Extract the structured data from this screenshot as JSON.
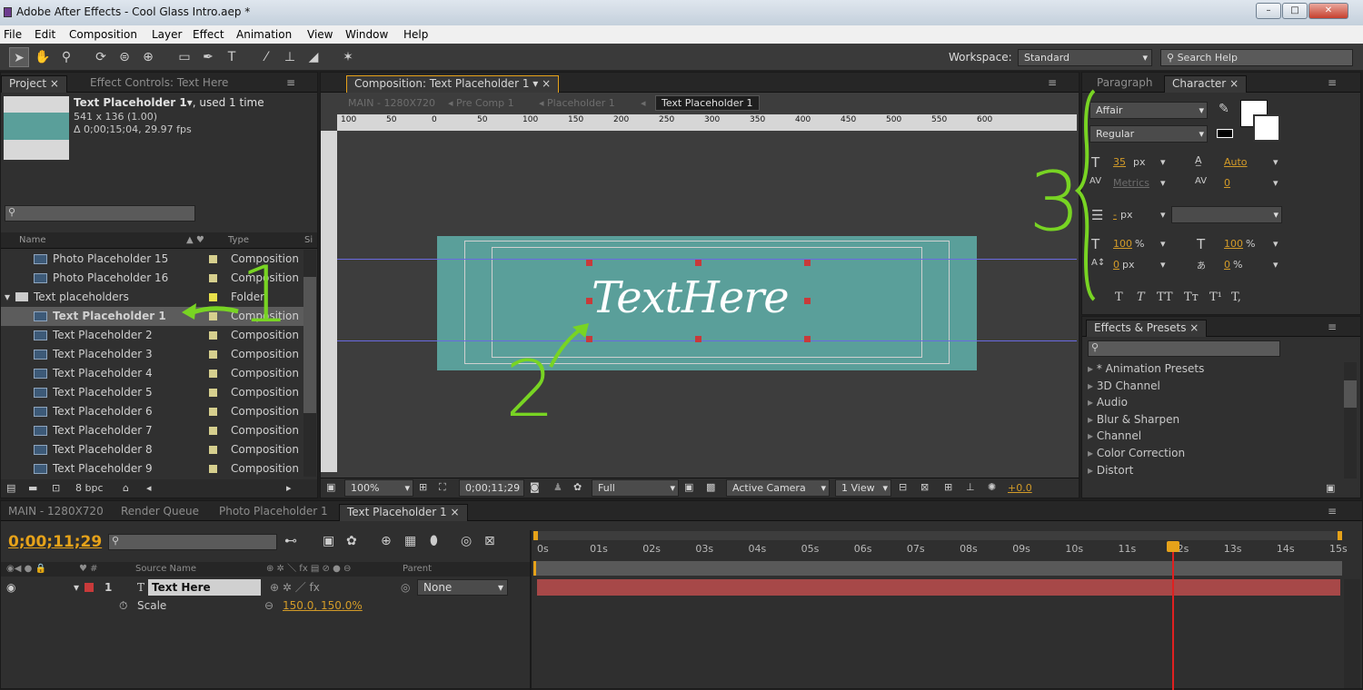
{
  "window": {
    "title": "Adobe After Effects - Cool Glass Intro.aep *",
    "min": "–",
    "max": "□",
    "close": "✕"
  },
  "menu": [
    "File",
    "Edit",
    "Composition",
    "Layer",
    "Effect",
    "Animation",
    "View",
    "Window",
    "Help"
  ],
  "workspace": {
    "label": "Workspace:",
    "value": "Standard",
    "search_placeholder": "Search Help"
  },
  "project": {
    "tab": "Project",
    "effect_tab": "Effect Controls: Text Here",
    "comp_name": "Text Placeholder 1▾",
    "used": ", used 1 time",
    "dims": "541 x 136 (1.00)",
    "duration": "Δ 0;00;15;04, 29.97 fps",
    "col_name": "Name",
    "col_type": "Type",
    "col_size": "Si",
    "items": [
      {
        "name": "Photo Placeholder 15",
        "type": "Composition"
      },
      {
        "name": "Photo Placeholder 16",
        "type": "Composition"
      },
      {
        "name": "Text placeholders",
        "type": "Folder"
      },
      {
        "name": "Text Placeholder 1",
        "type": "Composition"
      },
      {
        "name": "Text Placeholder 2",
        "type": "Composition"
      },
      {
        "name": "Text Placeholder 3",
        "type": "Composition"
      },
      {
        "name": "Text Placeholder 4",
        "type": "Composition"
      },
      {
        "name": "Text Placeholder 5",
        "type": "Composition"
      },
      {
        "name": "Text Placeholder 6",
        "type": "Composition"
      },
      {
        "name": "Text Placeholder 7",
        "type": "Composition"
      },
      {
        "name": "Text Placeholder 8",
        "type": "Composition"
      },
      {
        "name": "Text Placeholder 9",
        "type": "Composition"
      }
    ],
    "bpc": "8 bpc"
  },
  "composition": {
    "tab": "Composition: Text Placeholder 1",
    "crumbs": [
      "MAIN - 1280X720",
      "Pre Comp 1",
      "Placeholder 1",
      "Text Placeholder 1"
    ],
    "ruler": [
      "100",
      "50",
      "0",
      "50",
      "100",
      "150",
      "200",
      "250",
      "300",
      "350",
      "400",
      "450",
      "500",
      "550",
      "600"
    ],
    "canvas_text": "TextHere",
    "zoom": "100%",
    "time": "0;00;11;29",
    "res": "Full",
    "camera": "Active Camera",
    "view": "1 View",
    "exposure": "+0.0"
  },
  "character": {
    "tab_para": "Paragraph",
    "tab_char": "Character",
    "font": "Affair",
    "style": "Regular",
    "size": "35",
    "size_unit": "px",
    "leading": "Auto",
    "kern": "Metrics",
    "track": "0",
    "stroke": "-",
    "stroke_unit": "px",
    "vscale": "100",
    "hscale": "100",
    "pct": "%",
    "baseline": "0",
    "base_unit": "px",
    "tsume": "0",
    "tsume_unit": "%",
    "styles": [
      "T",
      "T",
      "TT",
      "Tт",
      "T¹",
      "T,"
    ]
  },
  "effects": {
    "tab": "Effects & Presets",
    "items": [
      "* Animation Presets",
      "3D Channel",
      "Audio",
      "Blur & Sharpen",
      "Channel",
      "Color Correction",
      "Distort"
    ]
  },
  "timeline": {
    "tabs": [
      "MAIN - 1280X720",
      "Render Queue",
      "Photo Placeholder 1",
      "Text Placeholder 1"
    ],
    "time": "0;00;11;29",
    "col_source": "Source Name",
    "col_parent": "Parent",
    "layer_num": "1",
    "layer_name": "Text Here",
    "parent": "None",
    "prop": "Scale",
    "prop_val": "150.0, 150.0%",
    "ticks": [
      "0s",
      "01s",
      "02s",
      "03s",
      "04s",
      "05s",
      "06s",
      "07s",
      "08s",
      "09s",
      "10s",
      "11s",
      "12s",
      "13s",
      "14s",
      "15s"
    ],
    "playhead_fraction": 0.79
  },
  "annotations": [
    "1",
    "2",
    "3"
  ],
  "colors": {
    "accent": "#e6a21a",
    "annotation": "#78d423",
    "comp_bg": "#5a9f9a",
    "layer_bar": "#a74848",
    "playhead": "#e02020"
  }
}
